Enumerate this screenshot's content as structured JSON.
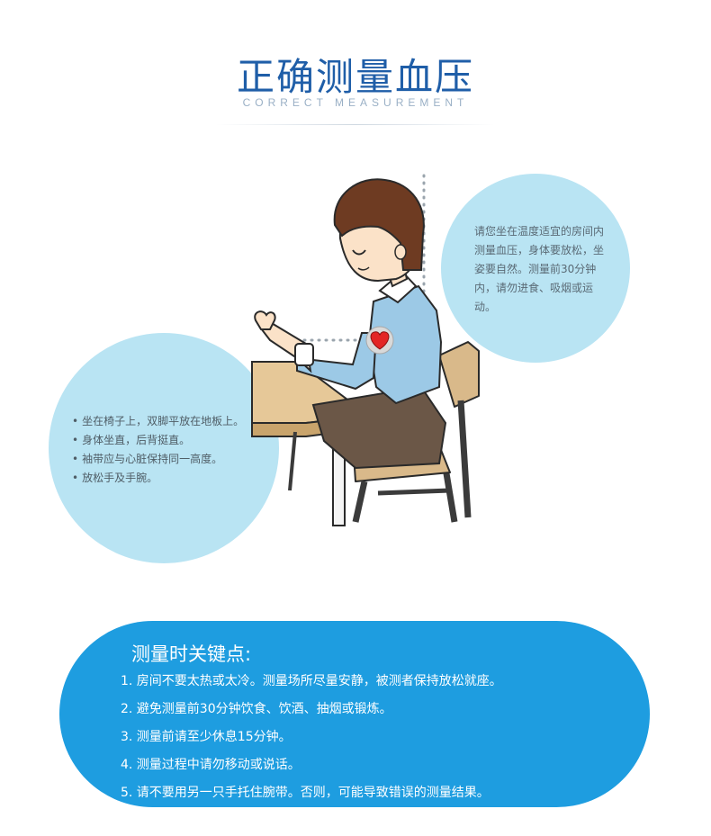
{
  "header": {
    "title": "正确测量血压",
    "subtitle": "CORRECT MEASUREMENT"
  },
  "bubble_right": {
    "text": "请您坐在温度适宜的房间内测量血压，身体要放松，坐姿要自然。测量前30分钟内，请勿进食、吸烟或运动。"
  },
  "bubble_left": {
    "items": [
      "坐在椅子上，双脚平放在地板上。",
      "身体坐直，后背挺直。",
      "袖带应与心脏保持同一高度。",
      "放松手及手腕。"
    ]
  },
  "key_points": {
    "title": "测量时关键点:",
    "items": [
      "1. 房间不要太热或太冷。测量场所尽量安静，被测者保持放松就座。",
      "2. 避免测量前30分钟饮食、饮酒、抽烟或锻炼。",
      "3. 测量前请至少休息15分钟。",
      "4. 测量过程中请勿移动或说话。",
      "5. 请不要用另一只手托住腕带。否则，可能导致错误的测量结果。"
    ]
  },
  "colors": {
    "title": "#1f5ea8",
    "bubble": "#b9e4f3",
    "pill": "#1e9de0"
  },
  "icons": {
    "heart": "heart-icon"
  }
}
